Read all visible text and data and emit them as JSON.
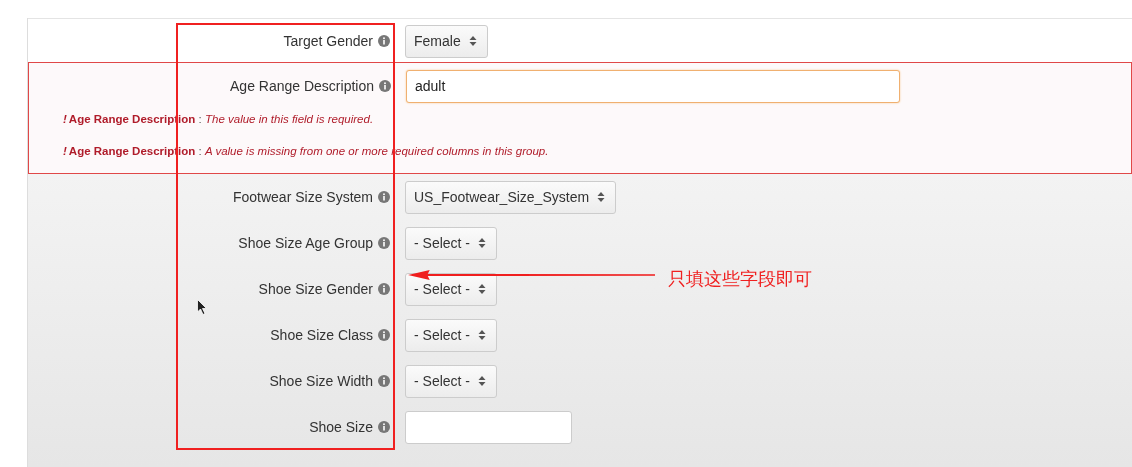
{
  "sections": [
    {
      "kind": "plain",
      "rows": [
        {
          "label": "Target Gender",
          "kind": "select",
          "value": "Female"
        }
      ]
    },
    {
      "kind": "error",
      "rows": [
        {
          "label": "Age Range Description",
          "kind": "text",
          "value": "adult"
        }
      ],
      "errors": [
        {
          "mark": "!",
          "field": "Age Range Description",
          "separator": ":",
          "message": "The value in this field is required."
        },
        {
          "mark": "!",
          "field": "Age Range Description",
          "separator": ":",
          "message": "A value is missing from one or more required columns in this group."
        }
      ]
    },
    {
      "kind": "gray",
      "rows": [
        {
          "label": "Footwear Size System",
          "kind": "select",
          "value": "US_Footwear_Size_System"
        },
        {
          "label": "Shoe Size Age Group",
          "kind": "select",
          "value": "- Select -"
        },
        {
          "label": "Shoe Size Gender",
          "kind": "select",
          "value": "- Select -"
        },
        {
          "label": "Shoe Size Class",
          "kind": "select",
          "value": "- Select -"
        },
        {
          "label": "Shoe Size Width",
          "kind": "select",
          "value": "- Select -"
        },
        {
          "label": "Shoe Size",
          "kind": "text"
        }
      ]
    }
  ],
  "annotation": {
    "note": "只填这些字段即可"
  }
}
